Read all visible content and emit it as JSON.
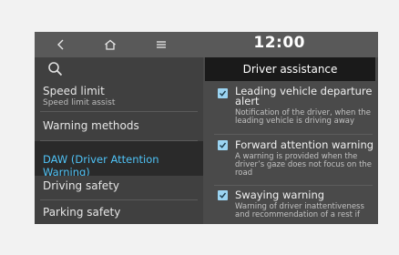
{
  "topbar": {
    "back_icon": "chevron-left-icon",
    "home_icon": "home-icon",
    "menu_icon": "menu-icon",
    "time": "12:00"
  },
  "sidebar": {
    "search_icon": "search-icon",
    "items": [
      {
        "label": "Speed limit",
        "sub": "Speed limit assist"
      },
      {
        "label": "Warning methods"
      },
      {
        "label": "DAW (Driver Attention Warning)"
      },
      {
        "label": "Driving safety"
      },
      {
        "label": "Parking safety"
      }
    ]
  },
  "panel": {
    "title": "Driver assistance",
    "options": [
      {
        "label": "Leading vehicle departure alert",
        "desc": "Notification of the driver, when the leading vehicle is driving away",
        "checked": true
      },
      {
        "label": "Forward attention warning",
        "desc": "A warning is provided when the driver’s gaze does not focus on the road",
        "checked": true
      },
      {
        "label": "Swaying warning",
        "desc": "Warning of driver inattentiveness and recommendation of a rest if",
        "checked": true
      }
    ]
  }
}
